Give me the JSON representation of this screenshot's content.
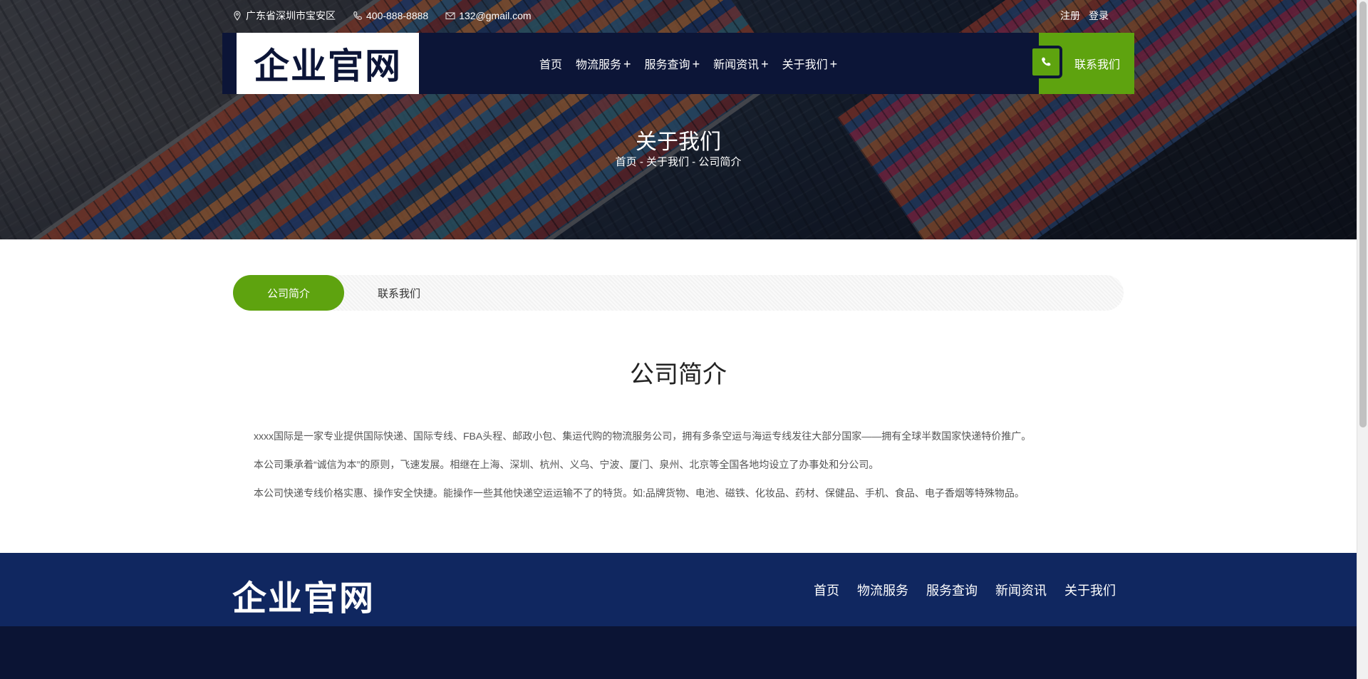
{
  "topbar": {
    "address": "广东省深圳市宝安区",
    "phone": "400-888-8888",
    "email": "132@gmail.com",
    "register": "注册",
    "login": "登录"
  },
  "header": {
    "logo": "企业官网",
    "menu": [
      {
        "label": "首页",
        "has_sub": false
      },
      {
        "label": "物流服务",
        "has_sub": true
      },
      {
        "label": "服务查询",
        "has_sub": true
      },
      {
        "label": "新闻资讯",
        "has_sub": true
      },
      {
        "label": "关于我们",
        "has_sub": true
      }
    ],
    "plus": "+",
    "contact": "联系我们"
  },
  "hero": {
    "title": "关于我们",
    "breadcrumb": "首页 - 关于我们 - 公司简介"
  },
  "tabs": {
    "active": "公司简介",
    "other": "联系我们"
  },
  "content": {
    "title": "公司简介",
    "paragraphs": [
      "xxxx国际是一家专业提供国际快递、国际专线、FBA头程、邮政小包、集运代购的物流服务公司，拥有多条空运与海运专线发往大部分国家——拥有全球半数国家快递特价推广。",
      "本公司秉承着“诚信为本”的原则，飞速发展。相继在上海、深圳、杭州、义乌、宁波、厦门、泉州、北京等全国各地均设立了办事处和分公司。",
      "本公司快递专线价格实惠、操作安全快捷。能操作一些其他快递空运运输不了的特货。如:品牌货物、电池、磁铁、化妆品、药材、保健品、手机、食品、电子香烟等特殊物品。"
    ]
  },
  "footer": {
    "logo": "企业官网",
    "nav": [
      "首页",
      "物流服务",
      "服务查询",
      "新闻资讯",
      "关于我们"
    ]
  },
  "colors": {
    "accent_green": "#5ea30f",
    "nav_navy": "#0c1537",
    "footer_blue": "#102760"
  }
}
